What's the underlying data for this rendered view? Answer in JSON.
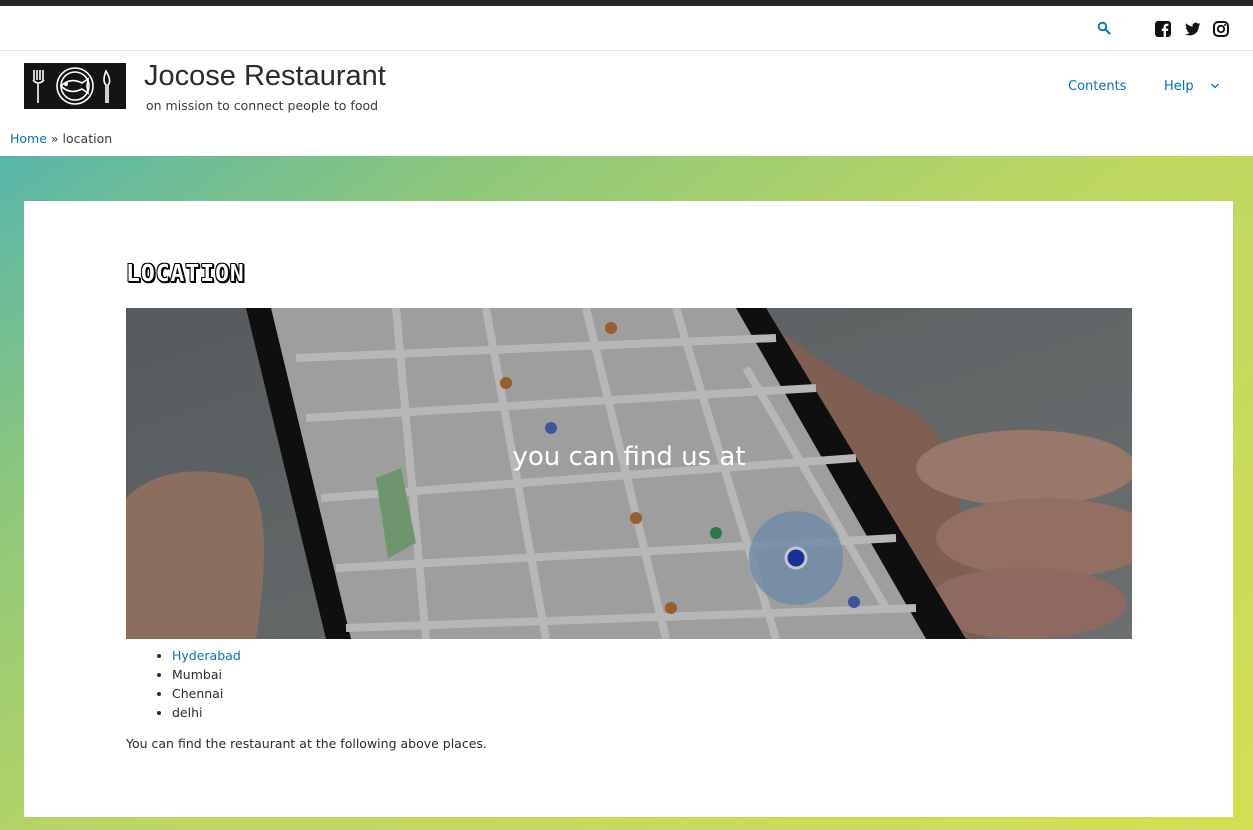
{
  "site": {
    "title": "Jocose Restaurant",
    "tagline": "on mission to connect people to food"
  },
  "utility_bar": {
    "icons": [
      "search-icon",
      "facebook-icon",
      "twitter-icon",
      "instagram-icon"
    ]
  },
  "nav": {
    "items": [
      {
        "label": "Contents"
      },
      {
        "label": "Help",
        "has_dropdown": true
      }
    ]
  },
  "breadcrumb": {
    "home": "Home",
    "separator": "»",
    "current": "location"
  },
  "page": {
    "title": "LOCATION",
    "hero_text": "you can find us at",
    "cities": [
      {
        "label": "Hyderabad",
        "is_link": true
      },
      {
        "label": "Mumbai",
        "is_link": false
      },
      {
        "label": "Chennai",
        "is_link": false
      },
      {
        "label": "delhi",
        "is_link": false
      }
    ],
    "note": "You can find the restaurant at the following above places."
  },
  "colors": {
    "link": "#0274be",
    "top_strip": "#24282d",
    "gradient_start": "#58b6ab",
    "gradient_end": "#d4df52"
  }
}
